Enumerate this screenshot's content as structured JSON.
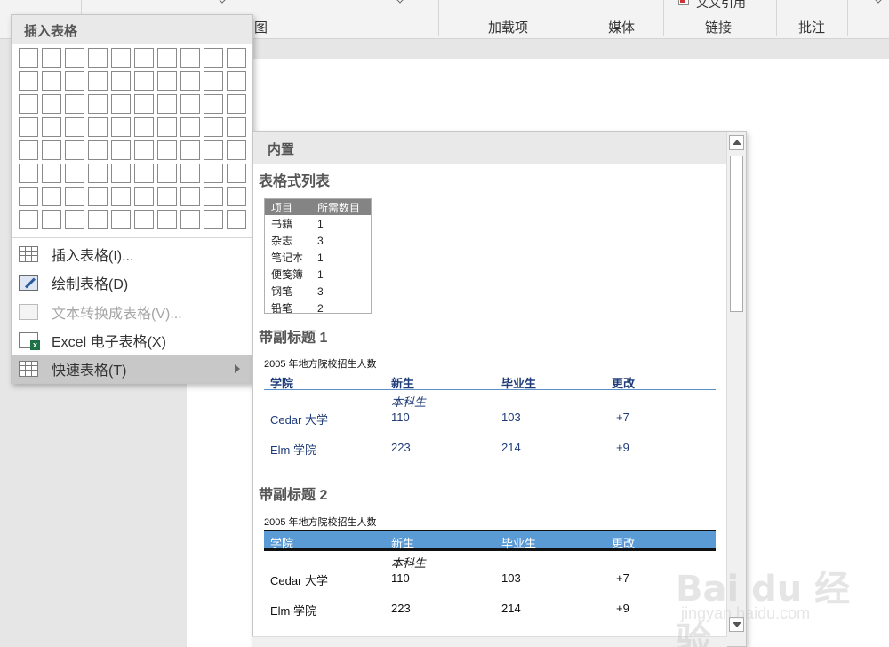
{
  "ribbon": {
    "groups": [
      {
        "label": "图"
      },
      {
        "label": "加载项"
      },
      {
        "label": "媒体"
      },
      {
        "label": "链接"
      },
      {
        "label": "批注"
      }
    ],
    "top_fragment": "文文引用"
  },
  "insert_table_menu": {
    "header": "插入表格",
    "grid": {
      "columns": 10,
      "rows": 8
    },
    "items": [
      {
        "label": "插入表格(I)...",
        "icon": "table-icon",
        "state": "normal"
      },
      {
        "label": "绘制表格(D)",
        "icon": "draw-table-icon",
        "state": "normal"
      },
      {
        "label": "文本转换成表格(V)...",
        "icon": "convert-text-icon",
        "state": "disabled"
      },
      {
        "label": "Excel 电子表格(X)",
        "icon": "excel-icon",
        "state": "normal"
      },
      {
        "label": "快速表格(T)",
        "icon": "table-icon",
        "state": "selected"
      }
    ]
  },
  "quick_tables": {
    "header": "内置",
    "sections": [
      {
        "title": "表格式列表",
        "table": {
          "columns": [
            "项目",
            "所需数目"
          ],
          "rows": [
            [
              "书籍",
              "1"
            ],
            [
              "杂志",
              "3"
            ],
            [
              "笔记本",
              "1"
            ],
            [
              "便笺簿",
              "1"
            ],
            [
              "钢笔",
              "3"
            ],
            [
              "铅笔",
              "2"
            ]
          ]
        }
      },
      {
        "title": "带副标题 1",
        "caption": "2005  年地方院校招生人数",
        "columns": [
          "学院",
          "新生",
          "毕业生",
          "更改"
        ],
        "subheading": "本科生",
        "rows": [
          [
            "Cedar 大学",
            "110",
            "103",
            "+7"
          ],
          [
            "Elm 学院",
            "223",
            "214",
            "+9"
          ]
        ]
      },
      {
        "title": "带副标题 2",
        "caption": "2005  年地方院校招生人数",
        "columns": [
          "学院",
          "新生",
          "毕业生",
          "更改"
        ],
        "subheading": "本科生",
        "rows": [
          [
            "Cedar 大学",
            "110",
            "103",
            "+7"
          ],
          [
            "Elm 学院",
            "223",
            "214",
            "+9"
          ]
        ]
      }
    ]
  },
  "watermark": {
    "brand": "Bai du 经验",
    "url": "jingyan.baidu.com"
  },
  "colors": {
    "accent_blue": "#5b9bd5",
    "dark_blue_text": "#1f3c78",
    "menu_header_bg": "#e9e9e9"
  }
}
